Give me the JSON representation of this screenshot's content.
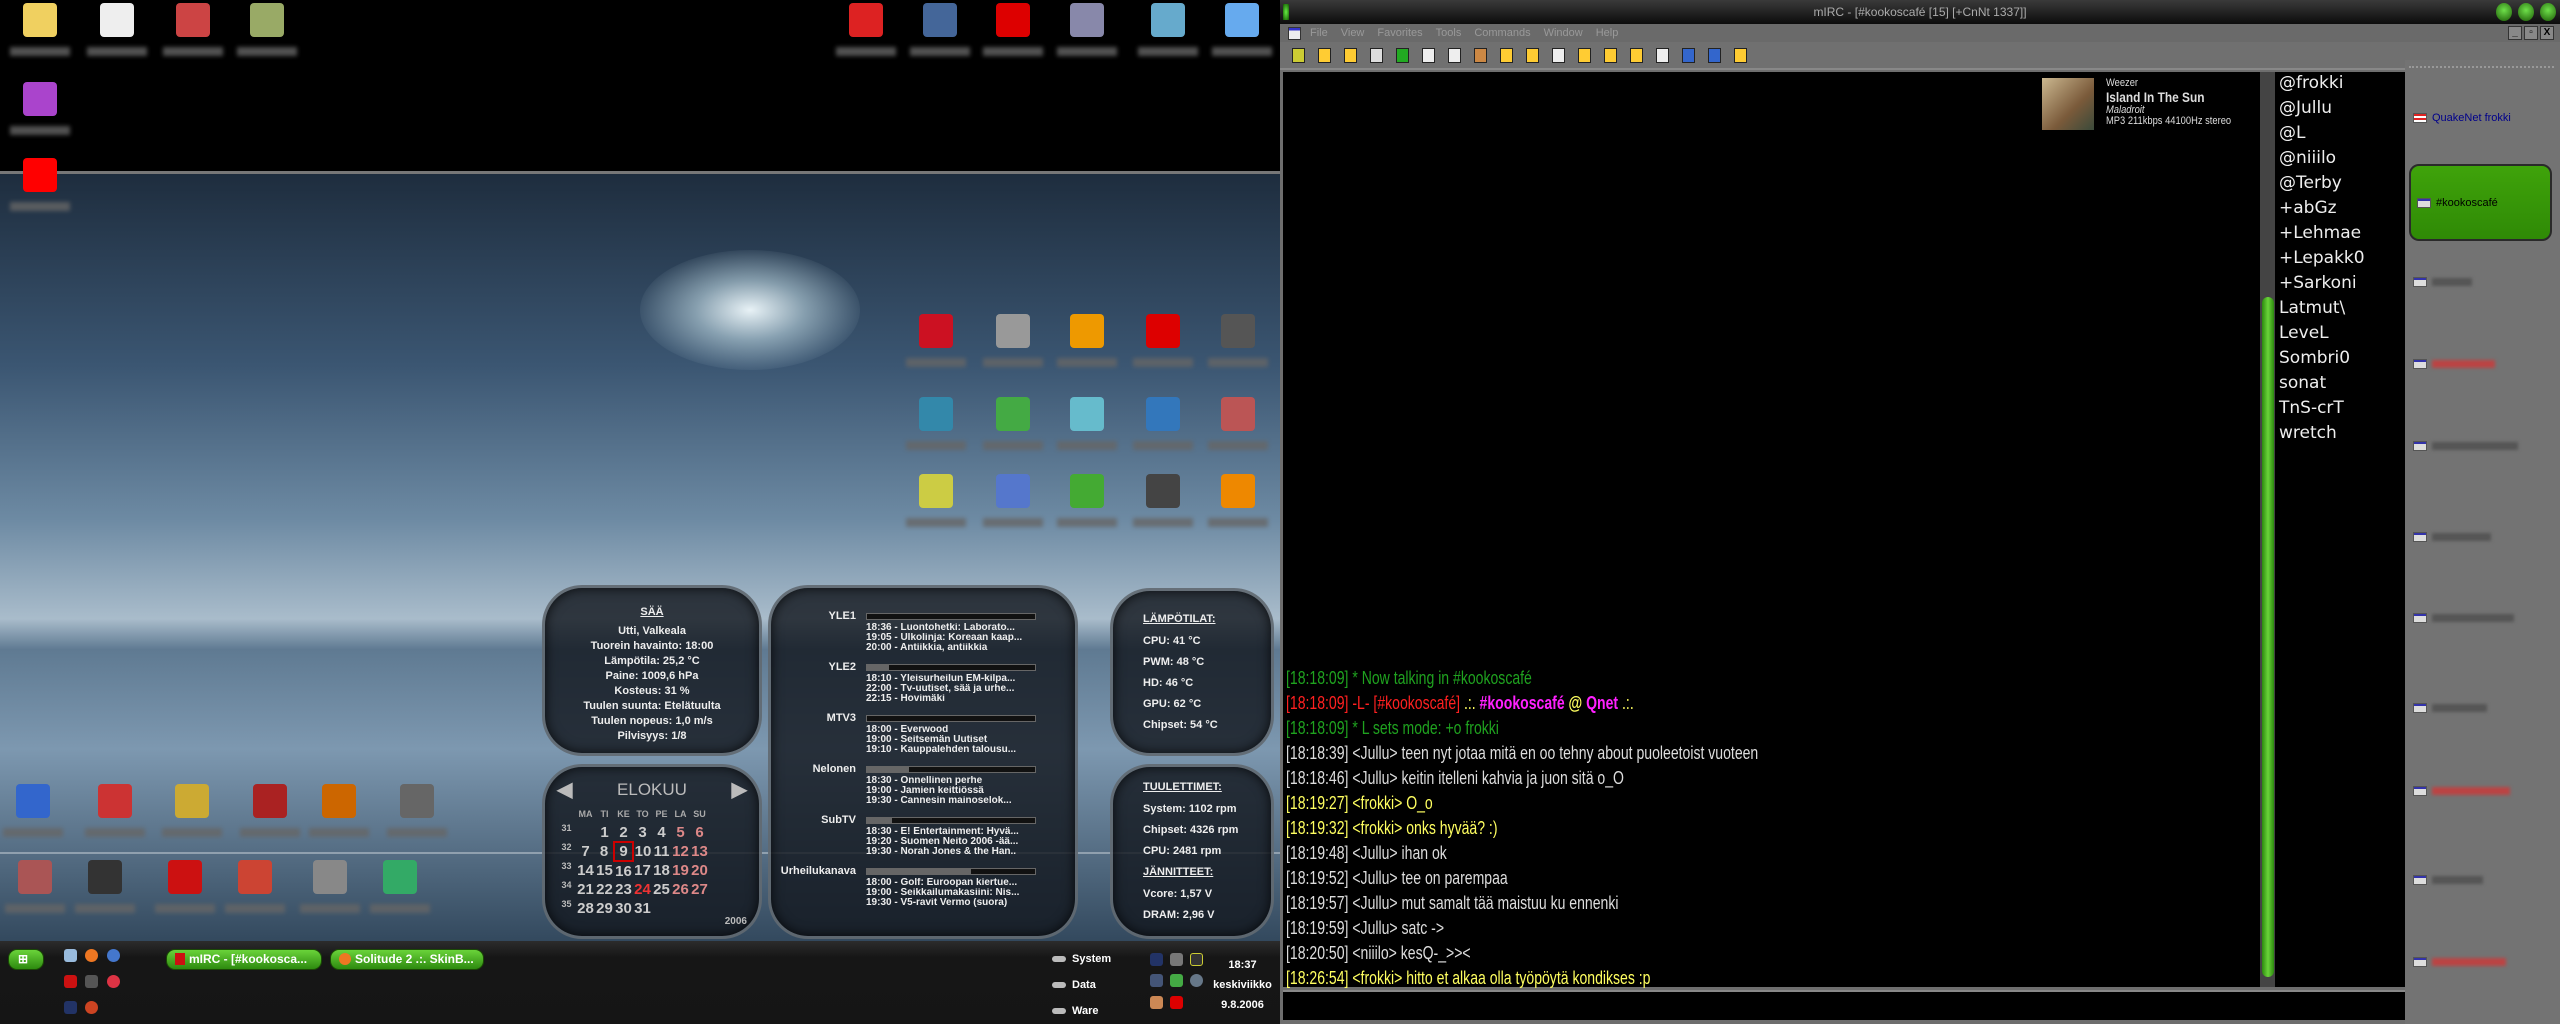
{
  "desktop": {
    "top_icons": [
      {
        "icon": "folder-icon",
        "color": "#f0d060"
      },
      {
        "icon": "notepad-icon",
        "color": "#eeeeee"
      },
      {
        "icon": "windows-logo-icon",
        "color": "#c44"
      },
      {
        "icon": "psd-file-icon",
        "color": "#9a6"
      },
      {
        "icon": "winrar-icon",
        "color": "#a4c"
      },
      {
        "icon": "red-splat-icon",
        "color": "#f00"
      }
    ],
    "top_right_icons": [
      {
        "icon": "adaware-icon",
        "color": "#d22"
      },
      {
        "icon": "spybot-icon",
        "color": "#469"
      },
      {
        "icon": "antivir-icon",
        "color": "#d00"
      },
      {
        "icon": "printer-icon",
        "color": "#88a"
      },
      {
        "icon": "cd-installer-icon",
        "color": "#6ac"
      },
      {
        "icon": "recycle-bin-icon",
        "color": "#6ae"
      }
    ],
    "grid_icons": [
      {
        "icon": "app-icon",
        "color": "#c12"
      },
      {
        "icon": "app-icon",
        "color": "#999"
      },
      {
        "icon": "app-icon",
        "color": "#e90"
      },
      {
        "icon": "app-icon",
        "color": "#d00"
      },
      {
        "icon": "app-icon",
        "color": "#555"
      },
      {
        "icon": "app-icon",
        "color": "#38a"
      },
      {
        "icon": "app-icon",
        "color": "#4a4"
      },
      {
        "icon": "app-icon",
        "color": "#6bc"
      },
      {
        "icon": "app-icon",
        "color": "#37b"
      },
      {
        "icon": "app-icon",
        "color": "#b55"
      },
      {
        "icon": "app-icon",
        "color": "#cc4"
      },
      {
        "icon": "app-icon",
        "color": "#57c"
      },
      {
        "icon": "app-icon",
        "color": "#4a3"
      },
      {
        "icon": "app-icon",
        "color": "#444"
      },
      {
        "icon": "app-icon",
        "color": "#e80"
      }
    ],
    "bottom_icons": [
      {
        "icon": "app-icon",
        "color": "#36c"
      },
      {
        "icon": "app-icon",
        "color": "#c33"
      },
      {
        "icon": "app-icon",
        "color": "#ca3"
      },
      {
        "icon": "app-icon",
        "color": "#a22"
      },
      {
        "icon": "app-icon",
        "color": "#c60"
      },
      {
        "icon": "app-icon",
        "color": "#666"
      },
      {
        "icon": "app-icon",
        "color": "#a55"
      },
      {
        "icon": "app-icon",
        "color": "#333"
      },
      {
        "icon": "app-icon",
        "color": "#c11"
      },
      {
        "icon": "app-icon",
        "color": "#c43"
      },
      {
        "icon": "app-icon",
        "color": "#888"
      },
      {
        "icon": "app-icon",
        "color": "#3a6"
      }
    ]
  },
  "weather": {
    "title": "SÄÄ",
    "lines": [
      "Utti, Valkeala",
      "Tuorein havainto: 18:00",
      "Lämpötila: 25,2 °C",
      "Paine: 1009,6 hPa",
      "Kosteus: 31 %",
      "Tuulen suunta: Etelätuulta",
      "Tuulen nopeus: 1,0 m/s",
      "Pilvisyys: 1/8"
    ]
  },
  "calendar": {
    "month": "ELOKUU",
    "year": "2006",
    "weekdays": [
      "MA",
      "TI",
      "KE",
      "TO",
      "PE",
      "LA",
      "SU"
    ],
    "weeks": [
      {
        "week": "31",
        "days": [
          "",
          "1",
          "2",
          "3",
          "4",
          "5",
          "6"
        ]
      },
      {
        "week": "32",
        "days": [
          "7",
          "8",
          "9",
          "10",
          "11",
          "12",
          "13"
        ]
      },
      {
        "week": "33",
        "days": [
          "14",
          "15",
          "16",
          "17",
          "18",
          "19",
          "20"
        ]
      },
      {
        "week": "34",
        "days": [
          "21",
          "22",
          "23",
          "24",
          "25",
          "26",
          "27"
        ]
      },
      {
        "week": "35",
        "days": [
          "28",
          "29",
          "30",
          "31",
          "",
          "",
          ""
        ]
      }
    ],
    "today": "9",
    "highlight": "24"
  },
  "tv": [
    {
      "channel": "YLE1",
      "progress": 0.0,
      "programs": [
        "18:36 - Luontohetki: Laborato...",
        "19:05 - Ulkolinja: Koreaan kaap...",
        "20:00 - Antiikkia, antiikkia"
      ]
    },
    {
      "channel": "YLE2",
      "progress": 0.13,
      "programs": [
        "18:10 - Yleisurheilun EM-kilpa...",
        "22:00 - Tv-uutiset, sää ja urhe...",
        "22:15 - Hovimäki"
      ]
    },
    {
      "channel": "MTV3",
      "progress": 0.0,
      "programs": [
        "18:00 - Everwood",
        "19:00 - Seitsemän Uutiset",
        "19:10 - Kauppalehden talousu..."
      ]
    },
    {
      "channel": "Nelonen",
      "progress": 0.25,
      "programs": [
        "18:30 - Onnellinen perhe",
        "19:00 - Jamien keittiössä",
        "19:30 - Cannesin mainoselok..."
      ]
    },
    {
      "channel": "SubTV",
      "progress": 0.15,
      "programs": [
        "18:30 - E! Entertainment: Hyvä...",
        "19:20 - Suomen Neito 2006 -ää...",
        "19:30 - Norah Jones & the Han.."
      ]
    },
    {
      "channel": "Urheilukanava",
      "progress": 0.62,
      "programs": [
        "18:00 - Golf: Euroopan kiertue...",
        "19:00 - Seikkailumakasiini: Nis...",
        "19:30 - V5-ravit Vermo (suora)"
      ]
    }
  ],
  "temps": {
    "title": "LÄMPÖTILAT:",
    "items": [
      "CPU: 41 °C",
      "PWM: 48 °C",
      "HD: 46 °C",
      "GPU: 62 °C",
      "Chipset: 54 °C"
    ]
  },
  "fans": {
    "title": "TUULETTIMET:",
    "items": [
      "System: 1102 rpm",
      "Chipset: 4326 rpm",
      "CPU: 2481 rpm"
    ]
  },
  "volts": {
    "title": "JÄNNITTEET:",
    "items": [
      "Vcore: 1,57 V",
      "DRAM: 2,96 V"
    ]
  },
  "taskbar": {
    "tasks": [
      {
        "label": "mIRC - [#kookosca...",
        "icon": "mirc-icon"
      },
      {
        "label": "Solitude 2 .:. SkinB...",
        "icon": "firefox-icon"
      }
    ],
    "drives": [
      "System",
      "Data",
      "Ware"
    ],
    "clock": {
      "time": "18:37",
      "day": "keskiviikko",
      "date": "9.8.2006"
    }
  },
  "mirc": {
    "title": "mIRC - [#kookoscafé [15] [+CnNt 1337]]",
    "menu": [
      "File",
      "View",
      "Favorites",
      "Tools",
      "Commands",
      "Window",
      "Help"
    ],
    "now_playing": {
      "artist": "Weezer",
      "track": "Island In The Sun",
      "album": "Maladroit",
      "info": "MP3 211kbps 44100Hz stereo"
    },
    "messages": [
      {
        "parts": [
          {
            "t": "[18:18:09] * Now talking in #kookoscafé",
            "c": "#1fa21f"
          }
        ]
      },
      {
        "parts": [
          {
            "t": "[18:18:09] -L- [#kookoscafé] ",
            "c": "#ff2020"
          },
          {
            "t": ".:. ",
            "c": "#ffff60"
          },
          {
            "t": "#kookoscafé ",
            "c": "#ff20ff",
            "b": true
          },
          {
            "t": "@ ",
            "c": "#ffff60",
            "b": true
          },
          {
            "t": "Qnet ",
            "c": "#ff20ff",
            "b": true
          },
          {
            "t": ".:.",
            "c": "#ffff60"
          }
        ]
      },
      {
        "parts": [
          {
            "t": "[18:18:09] * L sets mode: +o frokki",
            "c": "#1fa21f"
          }
        ]
      },
      {
        "parts": [
          {
            "t": "[18:18:39] <Jullu> teen nyt jotaa mitä en oo tehny about puoleetoist vuoteen",
            "c": "#dddddd"
          }
        ]
      },
      {
        "parts": [
          {
            "t": "[18:18:46] <Jullu> keitin itelleni kahvia ja juon sitä o_O",
            "c": "#dddddd"
          }
        ]
      },
      {
        "parts": [
          {
            "t": "[18:19:27] <frokki> O_o",
            "c": "#ffff60"
          }
        ]
      },
      {
        "parts": [
          {
            "t": "[18:19:32] <frokki> onks hyvää? :)",
            "c": "#ffff60"
          }
        ]
      },
      {
        "parts": [
          {
            "t": "[18:19:48] <Jullu> ihan ok",
            "c": "#dddddd"
          }
        ]
      },
      {
        "parts": [
          {
            "t": "[18:19:52] <Jullu> tee on parempaa",
            "c": "#dddddd"
          }
        ]
      },
      {
        "parts": [
          {
            "t": "[18:19:57] <Jullu> mut samalt tää maistuu ku ennenki",
            "c": "#dddddd"
          }
        ]
      },
      {
        "parts": [
          {
            "t": "[18:19:59] <Jullu> satc ->",
            "c": "#dddddd"
          }
        ]
      },
      {
        "parts": [
          {
            "t": "[18:20:50] <niiilo> kesQ-_>><",
            "c": "#dddddd"
          }
        ]
      },
      {
        "parts": [
          {
            "t": "[18:26:54] <frokki> hitto et alkaa olla työpöytä kondikses :p",
            "c": "#ffff60"
          }
        ]
      }
    ],
    "nicks": [
      "@frokki",
      "@Jullu",
      "@L",
      "@niiilo",
      "@Terby",
      "+abGz",
      "+Lehmae",
      "+Lepakk0",
      "+Sarkoni",
      "Latmut\\",
      "LeveL",
      "Sombri0",
      "sonat",
      "TnS-crT",
      "wretch"
    ],
    "switchbar": {
      "status": "QuakeNet frokki",
      "active": "#kookoscafé",
      "accent": "#3fa30a"
    }
  }
}
